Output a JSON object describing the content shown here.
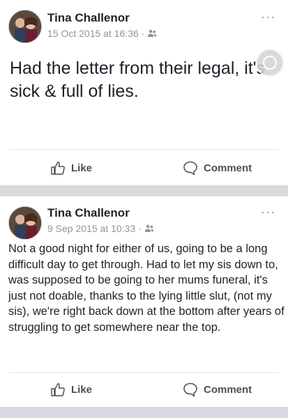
{
  "posts": [
    {
      "author": "Tina Challenor",
      "timestamp": "15 Oct 2015 at 16:36",
      "separator": "·",
      "privacy_icon": "friends-icon",
      "text": "Had the letter from their legal, it's  sick & full of lies.",
      "like_label": "Like",
      "comment_label": "Comment",
      "more_label": "···"
    },
    {
      "author": "Tina Challenor",
      "timestamp": "9 Sep 2015 at 10:33",
      "separator": "·",
      "privacy_icon": "friends-icon",
      "text": "Not a good night for either of us, going to be a long difficult day to get through. Had to let my sis down to, was supposed to be going to her mums funeral, it's just not doable, thanks to the lying little slut, (not my sis), we're right back down at the bottom after years of struggling to get somewhere near the top.",
      "like_label": "Like",
      "comment_label": "Comment",
      "more_label": "···"
    }
  ],
  "colors": {
    "background": "#d9dadf",
    "card": "#ffffff",
    "text": "#1d2129",
    "meta": "#90949c",
    "action": "#4b4f56"
  }
}
